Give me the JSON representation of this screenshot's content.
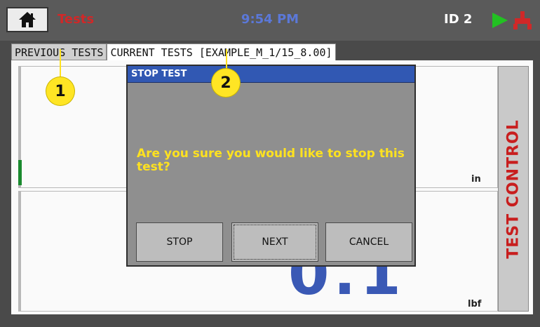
{
  "header": {
    "title": "Tests",
    "time": "9:54 PM",
    "device_id": "ID 2"
  },
  "tabs": [
    {
      "label": "PREVIOUS TESTS"
    },
    {
      "label": "CURRENT TESTS [EXAMPLE_M_1/15_8.00]"
    }
  ],
  "panels": {
    "top_unit": "in",
    "bottom_unit": "lbf",
    "bottom_value": "0.1"
  },
  "side_button": {
    "label": "TEST CONTROL"
  },
  "dialog": {
    "title": "STOP TEST",
    "message": "Are you sure you would like to stop this test?",
    "buttons": {
      "stop": "STOP",
      "next": "NEXT",
      "cancel": "CANCEL"
    }
  },
  "callouts": [
    "1",
    "2"
  ],
  "colors": {
    "accent_red": "#d02828",
    "time_blue": "#5b78d8",
    "dialog_title_blue": "#3158b3",
    "message_yellow": "#ffe21f",
    "status_green": "#22c122"
  },
  "icons": [
    "home-icon",
    "play-icon",
    "plug-icon"
  ]
}
